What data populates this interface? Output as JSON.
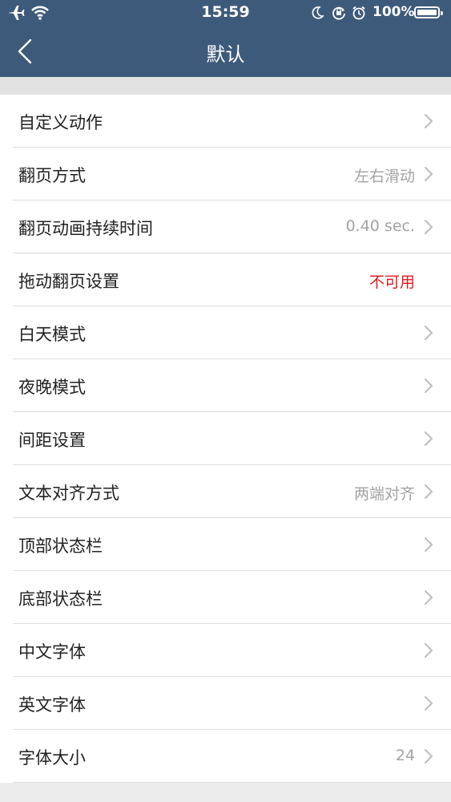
{
  "status_bar": {
    "time": "15:59",
    "battery": "100%",
    "icons": [
      "airplane-icon",
      "wifi-icon",
      "moon-icon",
      "orientation-lock-icon",
      "alarm-icon",
      "battery-icon"
    ]
  },
  "nav": {
    "title": "默认",
    "back_icon": "chevron-left-icon"
  },
  "colors": {
    "header_bg": "#3e5a7b",
    "value_gray": "#a3a3a3",
    "unavailable_red": "#e11b1b"
  },
  "settings": {
    "items": [
      {
        "label": "自定义动作",
        "value": ""
      },
      {
        "label": "翻页方式",
        "value": "左右滑动"
      },
      {
        "label": "翻页动画持续时间",
        "value": "0.40 sec."
      },
      {
        "label": "拖动翻页设置",
        "value": "不可用"
      },
      {
        "label": "白天模式",
        "value": ""
      },
      {
        "label": "夜晚模式",
        "value": ""
      },
      {
        "label": "间距设置",
        "value": ""
      },
      {
        "label": "文本对齐方式",
        "value": "两端对齐"
      },
      {
        "label": "顶部状态栏",
        "value": ""
      },
      {
        "label": "底部状态栏",
        "value": ""
      },
      {
        "label": "中文字体",
        "value": ""
      },
      {
        "label": "英文字体",
        "value": ""
      },
      {
        "label": "字体大小",
        "value": "24"
      }
    ]
  }
}
